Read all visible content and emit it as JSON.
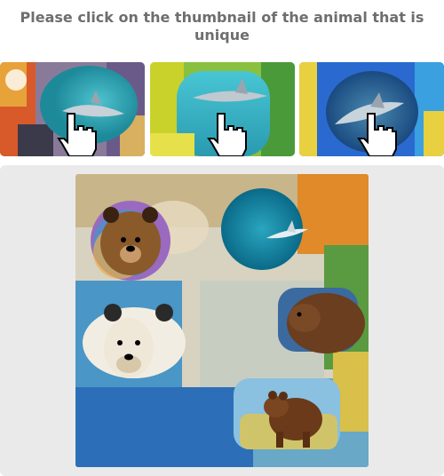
{
  "prompt": {
    "text": "Please click on the thumbnail of the animal that is unique"
  },
  "thumbnails": [
    {
      "animal": "shark",
      "style": "watercolor"
    },
    {
      "animal": "shark",
      "style": "watercolor"
    },
    {
      "animal": "shark",
      "style": "watercolor"
    }
  ],
  "main_image": {
    "content": "watercolor collage of bears with one shark"
  },
  "colors": {
    "prompt_text": "#6e6e6e",
    "panel_bg": "#eaeaea"
  }
}
